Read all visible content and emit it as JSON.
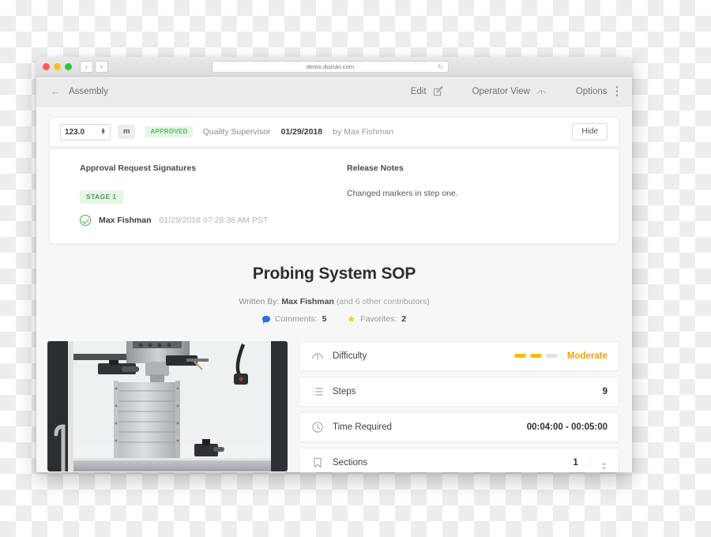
{
  "browser": {
    "url": "demo.dozuki.com",
    "reload_icon": "reload-icon",
    "back_label": "‹",
    "forward_label": "›"
  },
  "toolbar": {
    "back_icon": "back-arrow-icon",
    "breadcrumb": "Assembly",
    "edit_label": "Edit",
    "edit_icon": "pencil-square-icon",
    "operator_view_label": "Operator View",
    "operator_view_icon": "gauge-icon",
    "options_label": "Options",
    "options_icon": "kebab-menu-icon"
  },
  "version_bar": {
    "version_value": "123.0",
    "unit": "m",
    "status_badge": "APPROVED",
    "role": "Quality Supervisor",
    "date": "01/29/2018",
    "author": "by Max Fishman",
    "hide_label": "Hide"
  },
  "approval": {
    "signatures_title": "Approval Request Signatures",
    "stage_badge": "STAGE 1",
    "signer_name": "Max Fishman",
    "signer_timestamp": "01/29/2018 07:28:38 AM PST",
    "check_icon": "check-circle-icon",
    "release_notes_title": "Release Notes",
    "release_notes_text": "Changed markers in step one."
  },
  "document": {
    "title": "Probing System SOP",
    "written_by_prefix": "Written By:",
    "author": "Max Fishman",
    "contributors": "(and 6 other contributors)",
    "comments_label": "Comments:",
    "comments_count": "5",
    "comments_icon": "comment-bubble-icon",
    "favorites_label": "Favorites:",
    "favorites_count": "2",
    "favorites_icon": "star-icon"
  },
  "photo": {
    "alt": "cnc-milling-machine-photo"
  },
  "info_rows": [
    {
      "icon": "gauge-icon",
      "label": "Difficulty",
      "value": "Moderate",
      "bars_total": 3,
      "bars_filled": 2
    },
    {
      "icon": "list-icon",
      "label": "Steps",
      "value": "9"
    },
    {
      "icon": "clock-icon",
      "label": "Time Required",
      "value": "00:04:00 - 00:05:00"
    },
    {
      "icon": "bookmark-icon",
      "label": "Sections",
      "value": "1",
      "chevron_icon": "chevron-double-down-icon"
    }
  ],
  "colors": {
    "approved_green": "#5cb860",
    "difficulty_amber": "#fcba04",
    "difficulty_text": "#f0a500",
    "star_yellow": "#ffc400",
    "comment_blue": "#2f6fdd",
    "app_background": "#f7f7f7"
  }
}
